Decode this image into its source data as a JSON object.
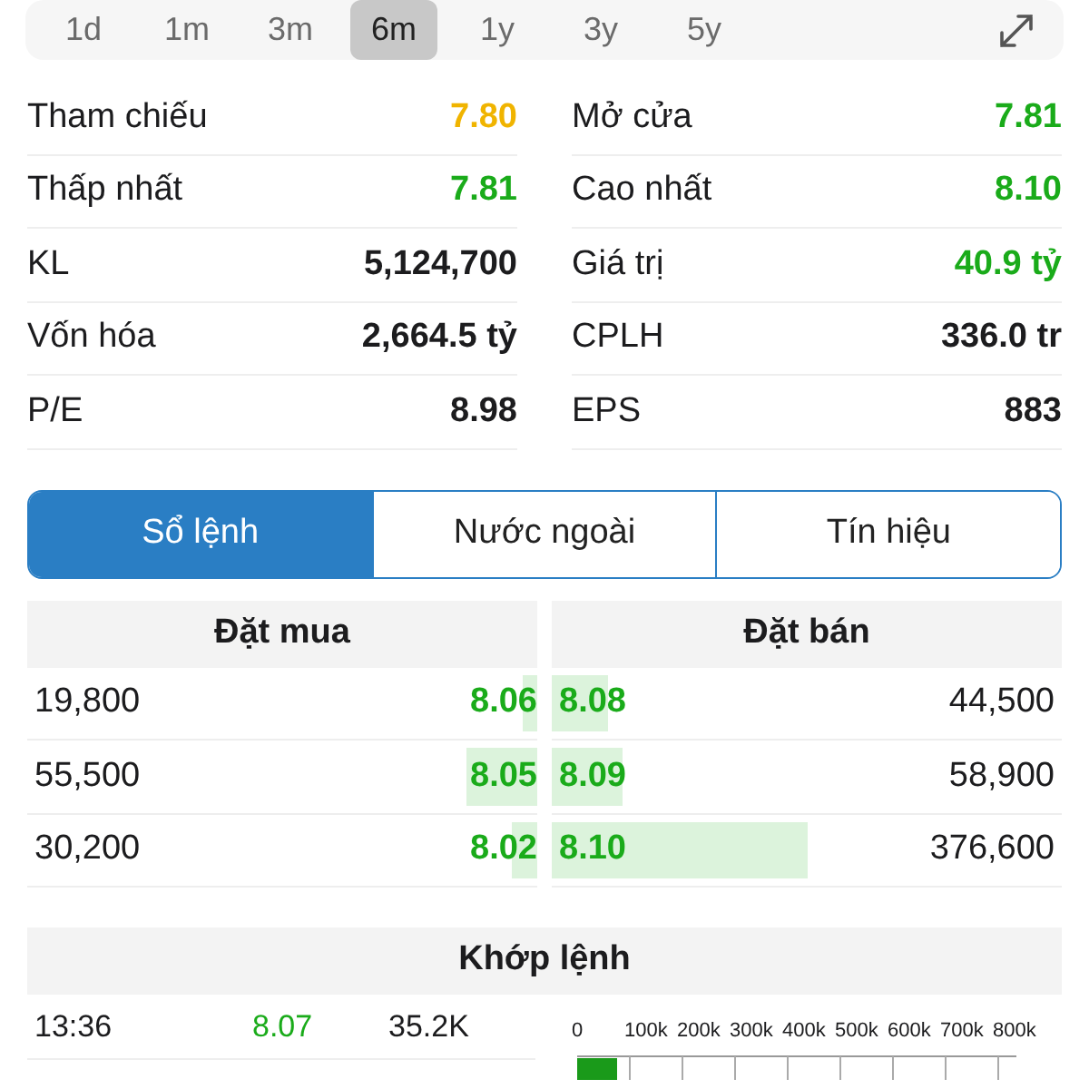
{
  "timeframes": [
    {
      "label": "1d",
      "selected": false
    },
    {
      "label": "1m",
      "selected": false
    },
    {
      "label": "3m",
      "selected": false
    },
    {
      "label": "6m",
      "selected": true
    },
    {
      "label": "1y",
      "selected": false
    },
    {
      "label": "3y",
      "selected": false
    },
    {
      "label": "5y",
      "selected": false
    }
  ],
  "stats": [
    [
      {
        "label": "Tham chiếu",
        "value": "7.80",
        "color": "#f0b400"
      },
      {
        "label": "Mở cửa",
        "value": "7.81",
        "color": "#1aab1a"
      }
    ],
    [
      {
        "label": "Thấp nhất",
        "value": "7.81",
        "color": "#1aab1a"
      },
      {
        "label": "Cao nhất",
        "value": "8.10",
        "color": "#1aab1a"
      }
    ],
    [
      {
        "label": "KL",
        "value": "5,124,700",
        "color": "#1c1c1e"
      },
      {
        "label": "Giá trị",
        "value": "40.9 tỷ",
        "color": "#1aab1a"
      }
    ],
    [
      {
        "label": "Vốn hóa",
        "value": "2,664.5 tỷ",
        "color": "#1c1c1e"
      },
      {
        "label": "CPLH",
        "value": "336.0 tr",
        "color": "#1c1c1e"
      }
    ],
    [
      {
        "label": "P/E",
        "value": "8.98",
        "color": "#1c1c1e"
      },
      {
        "label": "EPS",
        "value": "883",
        "color": "#1c1c1e"
      }
    ]
  ],
  "tabs": [
    {
      "label": "Sổ lệnh",
      "selected": true
    },
    {
      "label": "Nước ngoài",
      "selected": false
    },
    {
      "label": "Tín hiệu",
      "selected": false
    }
  ],
  "order_book": {
    "bid_title": "Đặt mua",
    "ask_title": "Đặt bán",
    "rows": [
      {
        "bid": {
          "volume": "19,800",
          "price": "8.06",
          "level": 0.03
        },
        "ask": {
          "price": "8.08",
          "level": 0.11,
          "volume": "44,500"
        }
      },
      {
        "bid": {
          "volume": "55,500",
          "price": "8.05",
          "level": 0.14
        },
        "ask": {
          "price": "8.09",
          "level": 0.14,
          "volume": "58,900"
        }
      },
      {
        "bid": {
          "volume": "30,200",
          "price": "8.02",
          "level": 0.05
        },
        "ask": {
          "price": "8.10",
          "level": 0.5,
          "volume": "376,600"
        }
      }
    ]
  },
  "matches": {
    "title": "Khớp lệnh",
    "trades": [
      {
        "time": "13:36",
        "price": "8.07",
        "volume": "35.2K"
      }
    ],
    "axis_ticks": [
      "0",
      "100k",
      "200k",
      "300k",
      "400k",
      "500k",
      "600k",
      "700k",
      "800k"
    ]
  }
}
